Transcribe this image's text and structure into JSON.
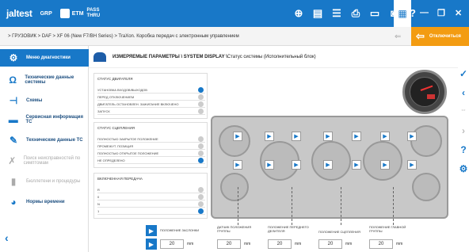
{
  "topbar": {
    "logo": "jaltest",
    "grp": "GRP",
    "etm": "ETM",
    "pass_line1": "PASS",
    "pass_line2": "THRU"
  },
  "breadcrumb": "> ГРУЗОВИК > DAF > XF 06 (New F7/BH Series) > TraXon. Коробка передач с электронным управлением",
  "exit_button": "Отключиться",
  "sidebar": {
    "items": [
      {
        "label": "Меню диагностики",
        "icon": "diagnostic-menu-icon"
      },
      {
        "label": "Технические данные системы",
        "icon": "magnet-icon"
      },
      {
        "label": "Схемы",
        "icon": "schema-icon"
      },
      {
        "label": "Сервисная информация ТС",
        "icon": "service-icon"
      },
      {
        "label": "Технические данные ТС",
        "icon": "wrench-icon"
      },
      {
        "label": "Поиск неисправностей по симптомам",
        "icon": "troubleshoot-icon"
      },
      {
        "label": "Бюллетени и процедуры",
        "icon": "bulletin-icon"
      },
      {
        "label": "Нормы времени",
        "icon": "time-icon"
      }
    ]
  },
  "title": {
    "main": "ИЗМЕРЯЕМЫЕ ПАРАМЕТРЫ \\ SYSTEM DISPLAY \\",
    "sub": " Статус системы (Исполнительный блок)"
  },
  "panels": {
    "engine_status": {
      "label": "СТАТУС ДВИГАТЕЛЯ",
      "rows": [
        {
          "text": "УСТАНОВКА ВХОДОВ/ВЫХОДОВ",
          "on": true
        },
        {
          "text": "ПЕРЕД ОТКЛЮЧЕНИЕМ",
          "on": false
        },
        {
          "text": "ДВИГАТЕЛЬ ОСТАНОВЛЕН. ЗАЖИГАНИЕ ВКЛЮЧЕНО",
          "on": false
        },
        {
          "text": "ЗАПУСК",
          "on": false
        }
      ]
    },
    "clutch_status": {
      "label": "СТАТУС СЦЕПЛЕНИЯ",
      "rows": [
        {
          "text": "ПОЛНОСТЬЮ ЗАКРЫТОЕ ПОЛОЖЕНИЕ",
          "on": false
        },
        {
          "text": "ПРОМЕЖУТ. ПОЗИЦИЯ",
          "on": false
        },
        {
          "text": "ПОЛНОСТЬЮ ОТКРЫТОЕ ПОЛОЖЕНИЕ",
          "on": false
        },
        {
          "text": "НЕ ОПРЕДЕЛЕНО",
          "on": true
        }
      ]
    },
    "gear_engaged": {
      "label": "ВКЛЮЧЕННАЯ ПЕРЕДАЧА",
      "rows": [
        {
          "text": "R",
          "on": false
        },
        {
          "text": "0",
          "on": false
        },
        {
          "text": "N",
          "on": false
        },
        {
          "text": "1",
          "on": true
        }
      ]
    }
  },
  "fields": [
    {
      "label": "ПОЛОЖЕНИЕ ЗАСЛОНКИ",
      "value": "20",
      "unit": "mm"
    },
    {
      "label": "ДАТЧИК ПОЛОЖЕНИЯ ГРУППЫ",
      "value": "20",
      "unit": "mm"
    },
    {
      "label": "ПОЛОЖЕНИЕ ПЕРЕДНЕГО ДЕЛИТЕЛЯ",
      "value": "20",
      "unit": "mm"
    },
    {
      "label": "ПОЛОЖЕНИЕ СЦЕПЛЕНИЯ",
      "value": "20",
      "unit": "mm"
    },
    {
      "label": "ПОЛОЖЕНИЕ ГЛАВНОЙ ГРУППЫ",
      "value": "20",
      "unit": "mm"
    }
  ]
}
